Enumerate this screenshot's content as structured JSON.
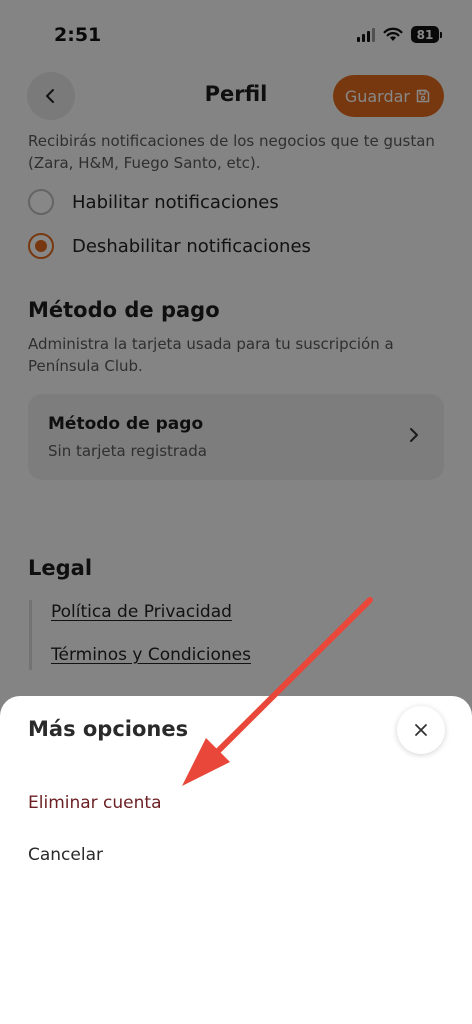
{
  "status_bar": {
    "time": "2:51",
    "battery": "81"
  },
  "nav": {
    "title": "Perfil",
    "save_label": "Guardar"
  },
  "notifications": {
    "description": "Recibirás notificaciones de los negocios que te gustan (Zara, H&M, Fuego Santo, etc).",
    "options": [
      {
        "label": "Habilitar notificaciones",
        "selected": false
      },
      {
        "label": "Deshabilitar notificaciones",
        "selected": true
      }
    ]
  },
  "payment": {
    "title": "Método de pago",
    "description": "Administra la tarjeta usada para tu suscripción a Península Club.",
    "card_title": "Método de pago",
    "card_subtitle": "Sin tarjeta registrada"
  },
  "legal": {
    "title": "Legal",
    "links": [
      "Política de Privacidad",
      "Términos y Condiciones"
    ]
  },
  "sheet": {
    "title": "Más opciones",
    "delete_label": "Eliminar cuenta",
    "cancel_label": "Cancelar"
  },
  "colors": {
    "accent": "#e36a1e",
    "annotation_arrow": "#e8473a",
    "delete_text": "#6b1f23"
  },
  "icons": {
    "back": "chevron-left-icon",
    "save": "floppy-disk-icon",
    "card": "chevron-right-icon",
    "close": "close-icon",
    "annotation": "arrow-icon"
  }
}
